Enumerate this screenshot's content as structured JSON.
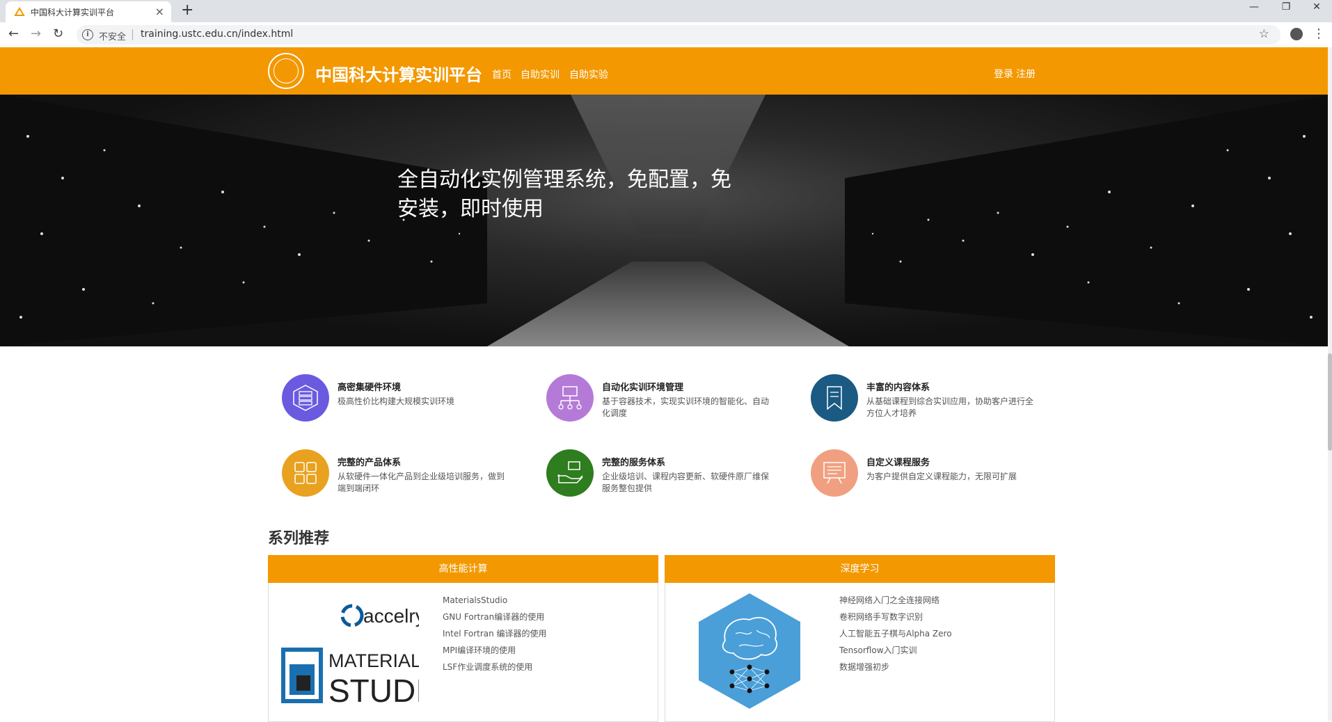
{
  "browser": {
    "tab_title": "中国科大计算实训平台",
    "insecure_label": "不安全",
    "url": "training.ustc.edu.cn/index.html"
  },
  "header": {
    "site_title": "中国科大计算实训平台",
    "nav": [
      "首页",
      "自助实训",
      "自助实验"
    ],
    "login": "登录",
    "register": "注册"
  },
  "hero": {
    "line1": "全自动化实例管理系统，免配置，免",
    "line2": "安装，即时使用"
  },
  "features": [
    {
      "title": "高密集硬件环境",
      "desc": "极高性价比构建大规模实训环境",
      "color": "#6a5ae0",
      "icon": "server-icon"
    },
    {
      "title": "自动化实训环境管理",
      "desc": "基于容器技术，实现实训环境的智能化、自动化调度",
      "color": "#b57ad8",
      "icon": "network-icon"
    },
    {
      "title": "丰富的内容体系",
      "desc": "从基础课程到综合实训应用，协助客户进行全方位人才培养",
      "color": "#1a5a83",
      "icon": "bookmark-icon"
    },
    {
      "title": "完整的产品体系",
      "desc": "从软硬件一体化产品到企业级培训服务，做到端到端闭环",
      "color": "#e8a21f",
      "icon": "grid-icon"
    },
    {
      "title": "完整的服务体系",
      "desc": "企业级培训、课程内容更新、软硬件原厂维保服务整包提供",
      "color": "#2e7d1e",
      "icon": "service-icon"
    },
    {
      "title": "自定义课程服务",
      "desc": "为客户提供自定义课程能力，无限可扩展",
      "color": "#f0a080",
      "icon": "presentation-icon"
    }
  ],
  "series": {
    "title": "系列推荐",
    "cards": [
      {
        "title": "高性能计算",
        "logo_text_1": "accelrys",
        "logo_text_2": "MATERIALS",
        "logo_text_3": "STUDIO",
        "items": [
          "MaterialsStudio",
          "GNU Fortran编译器的使用",
          "Intel Fortran 编译器的使用",
          "MPI编译环境的使用",
          "LSF作业调度系统的使用"
        ]
      },
      {
        "title": "深度学习",
        "items": [
          "神经网络入门之全连接网络",
          "卷积网络手写数字识别",
          "人工智能五子棋与Alpha Zero",
          "Tensorflow入门实训",
          "数据增强初步"
        ]
      }
    ]
  }
}
